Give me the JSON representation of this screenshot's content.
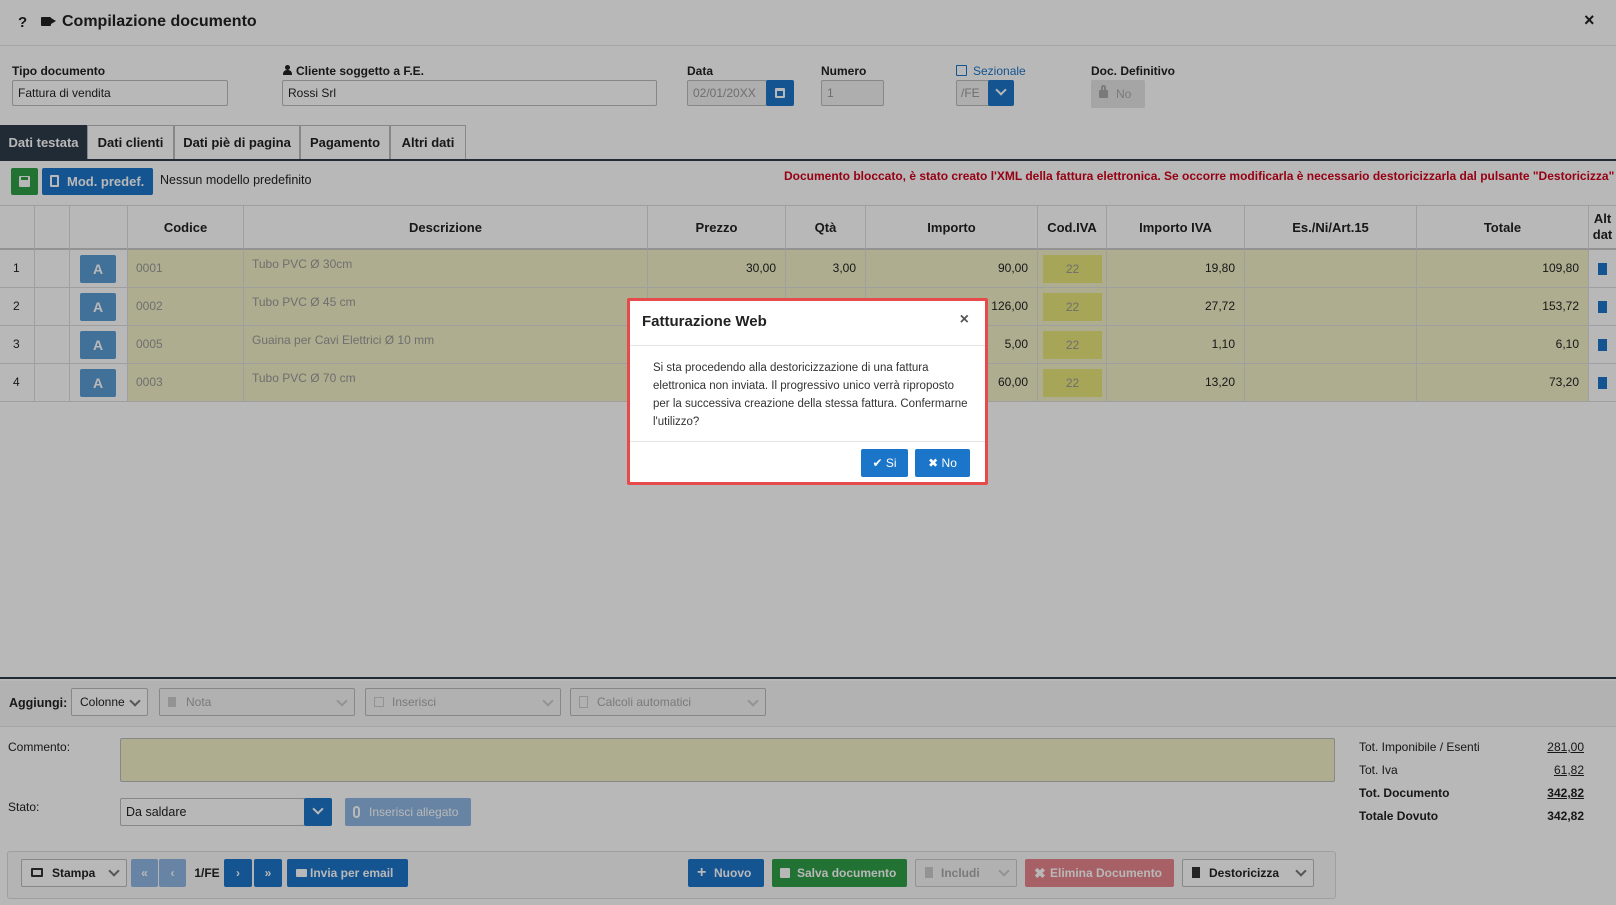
{
  "window": {
    "help": "?",
    "title": "Compilazione documento",
    "close": "×"
  },
  "fields": {
    "tipo_label": "Tipo documento",
    "tipo_value": "Fattura di vendita",
    "cliente_label": "Cliente soggetto a F.E.",
    "cliente_value": "Rossi Srl",
    "data_label": "Data",
    "data_value": "02/01/20XX",
    "numero_label": "Numero",
    "numero_value": "1",
    "sezionale_label": "Sezionale",
    "sezionale_value": "/FE",
    "definitivo_label": "Doc. Definitivo",
    "definitivo_value": "No"
  },
  "tabs": [
    "Dati testata",
    "Dati clienti",
    "Dati piè di pagina",
    "Pagamento",
    "Altri dati"
  ],
  "toolbar": {
    "mod_predef": "Mod. predef.",
    "nessun_modello": "Nessun modello predefinito",
    "warning": "Documento bloccato, è stato creato l'XML della fattura elettronica. Se occorre modificarla è necessario destoricizzarla dal pulsante \"Destoricizza\""
  },
  "grid": {
    "headers": [
      "Codice",
      "Descrizione",
      "Prezzo",
      "Qtà",
      "Importo",
      "Cod.IVA",
      "Importo IVA",
      "Es./Ni/Art.15",
      "Totale",
      "Alt dat"
    ],
    "rows": [
      {
        "n": "1",
        "btn": "A",
        "codice": "0001",
        "descrizione": "Tubo PVC Ø 30cm",
        "prezzo": "30,00",
        "qta": "3,00",
        "importo": "90,00",
        "iva": "22",
        "importo_iva": "19,80",
        "totale": "109,80"
      },
      {
        "n": "2",
        "btn": "A",
        "codice": "0002",
        "descrizione": "Tubo PVC Ø 45 cm",
        "prezzo": "",
        "qta": "",
        "importo": "126,00",
        "iva": "22",
        "importo_iva": "27,72",
        "totale": "153,72"
      },
      {
        "n": "3",
        "btn": "A",
        "codice": "0005",
        "descrizione": "Guaina per Cavi Elettrici Ø 10 mm",
        "prezzo": "",
        "qta": "",
        "importo": "5,00",
        "iva": "22",
        "importo_iva": "1,10",
        "totale": "6,10"
      },
      {
        "n": "4",
        "btn": "A",
        "codice": "0003",
        "descrizione": "Tubo PVC Ø 70 cm",
        "prezzo": "",
        "qta": "",
        "importo": "60,00",
        "iva": "22",
        "importo_iva": "13,20",
        "totale": "73,20"
      }
    ]
  },
  "aggiungi": {
    "label": "Aggiungi:",
    "colonne": "Colonne",
    "nota": "Nota",
    "inserisci": "Inserisci",
    "calcoli": "Calcoli automatici"
  },
  "footer": {
    "commento_label": "Commento:",
    "stato_label": "Stato:",
    "stato_value": "Da saldare",
    "allegato": "Inserisci allegato"
  },
  "totals": [
    {
      "label": "Tot. Imponibile / Esenti",
      "value": "281,00"
    },
    {
      "label": "Tot. Iva",
      "value": "61,82"
    },
    {
      "label": "Tot. Documento",
      "value": "342,82"
    },
    {
      "label": "Totale Dovuto",
      "value": "342,82"
    }
  ],
  "bottom_bar": {
    "stampa": "Stampa",
    "pager": "1/FE",
    "invia": "Invia per email",
    "nuovo": "Nuovo",
    "salva": "Salva documento",
    "includi": "Includi",
    "elimina": "Elimina Documento",
    "destoricizza": "Destoricizza"
  },
  "dialog": {
    "title": "Fatturazione Web",
    "body": "Si sta procedendo alla destoricizzazione di una fattura elettronica non inviata. Il progressivo unico verrà riproposto per la successiva creazione della stessa fattura. Confermarne l'utilizzo?",
    "yes": "Si",
    "no": "No",
    "close": "×"
  },
  "colors": {
    "accent": "#1b75c9",
    "tab_active": "#2f3c4c",
    "row_fill": "#f3f0c7",
    "iva_fill": "#e8e67a",
    "warning": "#d0021b",
    "dialog_border": "#e64a4a"
  }
}
